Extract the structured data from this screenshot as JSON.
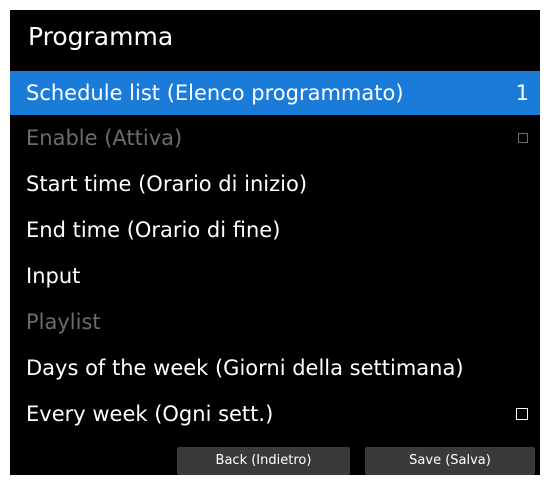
{
  "panel": {
    "title": "Programma"
  },
  "menu": {
    "items": [
      {
        "label": "Schedule list (Elenco programmato)",
        "value": "1"
      },
      {
        "label": "Enable (Attiva)"
      },
      {
        "label": "Start time (Orario di inizio)"
      },
      {
        "label": "End time (Orario di fine)"
      },
      {
        "label": "Input"
      },
      {
        "label": "Playlist"
      },
      {
        "label": "Days of the week (Giorni della settimana)"
      },
      {
        "label": "Every week (Ogni sett.)"
      }
    ]
  },
  "buttons": {
    "back_label": "Back (Indietro)",
    "save_label": "Save (Salva)"
  },
  "colors": {
    "background": "#000000",
    "selected": "#1b7bd8",
    "disabled_text": "#6c6c6c",
    "button": "#3a3a3a"
  }
}
